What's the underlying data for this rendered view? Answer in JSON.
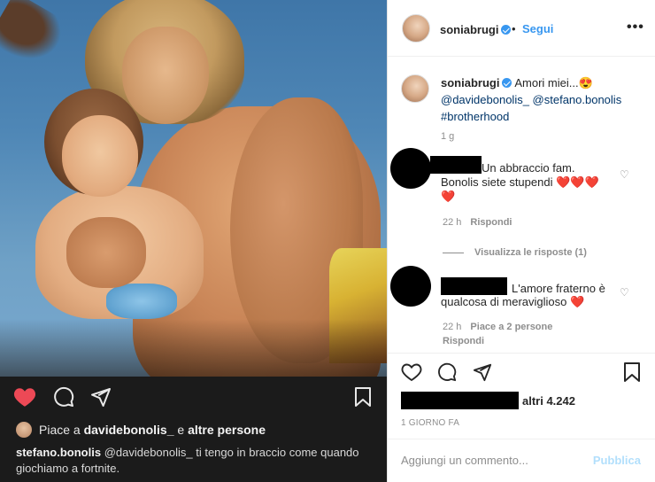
{
  "post": {
    "username": "soniabrugi",
    "follow_label": "Segui",
    "dot": "•",
    "more_label": "•••",
    "caption": {
      "username": "soniabrugi",
      "text": "Amori miei...😍",
      "mentions": "@davidebonolis_ @stefano.bonolis",
      "hashtag": "#brotherhood",
      "time": "1 g"
    }
  },
  "comments": [
    {
      "text_before": "Un abbraccio fam.",
      "text_after": "Bonolis siete stupendi ❤️❤️❤️",
      "text_last": "❤️",
      "time": "22 h",
      "reply_label": "Rispondi",
      "view_replies": "Visualizza le risposte (1)"
    },
    {
      "text_before": "L'amore fraterno è",
      "text_after": "qualcosa di meraviglioso ❤️",
      "time": "22 h",
      "likes": "Piace a 2 persone",
      "reply_label": "Rispondi"
    }
  ],
  "actions": {
    "likes_suffix": "altri 4.242",
    "date": "1 GIORNO FA"
  },
  "composer": {
    "placeholder": "Aggiungi un commento...",
    "publish": "Pubblica"
  },
  "left_panel": {
    "likes_prefix": "Piace a",
    "likes_user": "davidebonolis_",
    "likes_mid": "e",
    "likes_rest": "altre persone",
    "caption_user": "stefano.bonolis",
    "caption_text": "@davidebonolis_  ti tengo in braccio come quando giochiamo a fortnite."
  },
  "colors": {
    "accent": "#3897f0",
    "like_red": "#ed4956",
    "muted": "#8e8e8e"
  }
}
